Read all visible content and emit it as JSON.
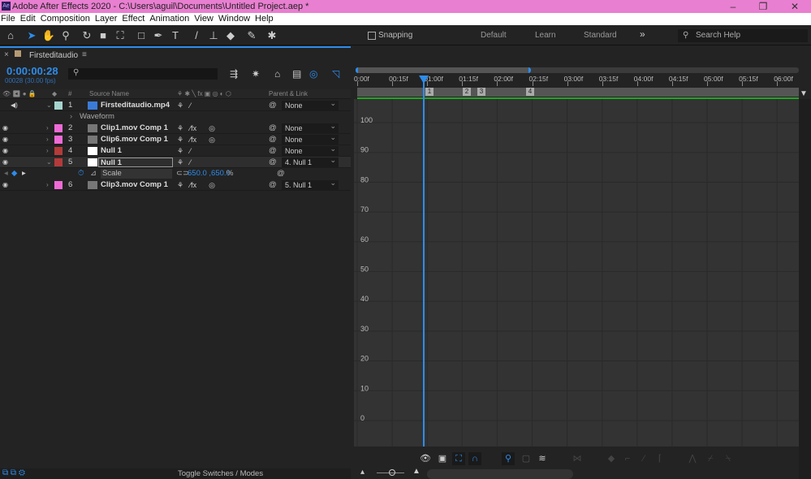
{
  "window": {
    "title": "Adobe After Effects 2020 - C:\\Users\\aguil\\Documents\\Untitled Project.aep *",
    "app_icon": "Ae",
    "minimize": "–",
    "maximize": "❐",
    "close": "✕"
  },
  "menu": [
    "File",
    "Edit",
    "Composition",
    "Layer",
    "Effect",
    "Animation",
    "View",
    "Window",
    "Help"
  ],
  "toolbar": {
    "snapping": "Snapping",
    "workspaces": [
      "Default",
      "Learn",
      "Standard"
    ],
    "more": "»",
    "search_placeholder": "Search Help"
  },
  "panel": {
    "tab": "Firsteditaudio",
    "menu": "≡",
    "close": "×"
  },
  "timeline": {
    "timecode": "0:00:00:28",
    "frames": "00028 (30.00 fps)",
    "columns": {
      "num": "#",
      "source": "Source Name",
      "parent": "Parent & Link"
    },
    "layers": [
      {
        "num": "1",
        "name": "Firsteditaudio.mp4",
        "label": "#a6d4cf",
        "parent": "None",
        "expanded": true,
        "fx": false,
        "audio": true
      },
      {
        "num": "2",
        "name": "Clip1.mov Comp 1",
        "label": "#f06ad6",
        "parent": "None",
        "fx": true
      },
      {
        "num": "3",
        "name": "Clip6.mov Comp 1",
        "label": "#f06ad6",
        "parent": "None",
        "fx": true
      },
      {
        "num": "4",
        "name": "Null 1",
        "label": "#b53a3a",
        "parent": "None",
        "fx": false
      },
      {
        "num": "5",
        "name": "Null 1",
        "label": "#b53a3a",
        "parent": "4. Null 1",
        "fx": false,
        "selected": true
      },
      {
        "num": "6",
        "name": "Clip3.mov Comp 1",
        "label": "#f06ad6",
        "parent": "5. Null 1",
        "fx": true
      }
    ],
    "waveform": "Waveform",
    "property": {
      "name": "Scale",
      "value": "650.0 ,650.0",
      "unit": "%"
    },
    "toggle": "Toggle Switches / Modes"
  },
  "ruler": {
    "ticks": [
      "0:00f",
      "00:15f",
      "01:00f",
      "01:15f",
      "02:00f",
      "02:15f",
      "03:00f",
      "03:15f",
      "04:00f",
      "04:15f",
      "05:00f",
      "05:15f",
      "06:00f"
    ],
    "markers": [
      "1",
      "2",
      "3",
      "4"
    ],
    "playhead_time": "00:28"
  },
  "graph": {
    "y_labels": [
      "100",
      "90",
      "80",
      "70",
      "60",
      "50",
      "40",
      "30",
      "20",
      "10",
      "0"
    ]
  },
  "colors": {
    "accent": "#2d8ceb",
    "work_area": "#1fa81f"
  }
}
